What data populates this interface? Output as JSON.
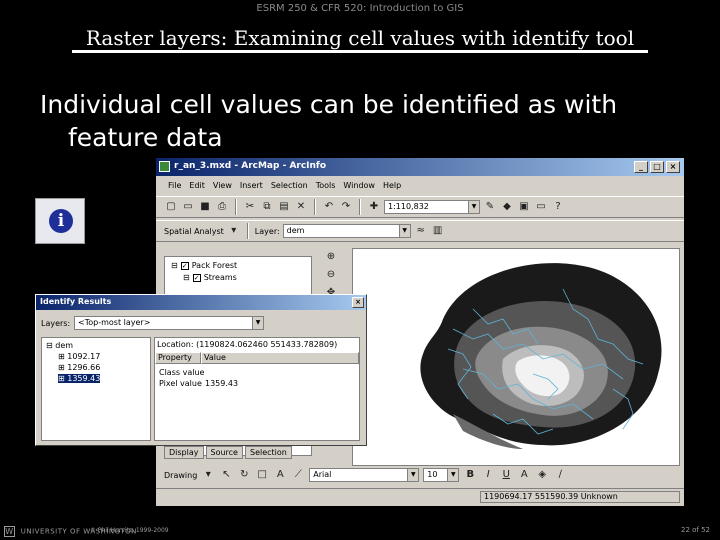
{
  "header": {
    "course": "ESRM 250 & CFR 520: Introduction to GIS"
  },
  "slide": {
    "title": "Raster layers: Examining cell values with identify tool",
    "bullet_line1": "Individual cell values can be identified as with",
    "bullet_line2": "feature data"
  },
  "arcmap": {
    "window_title": "r_an_3.mxd - ArcMap - ArcInfo",
    "menu": [
      "File",
      "Edit",
      "View",
      "Insert",
      "Selection",
      "Tools",
      "Window",
      "Help"
    ],
    "scale": "1:110,832",
    "spatial_analyst": "Spatial Analyst",
    "layer_label": "Layer:",
    "layer_value": "dem",
    "toc": {
      "root": "Pack Forest",
      "layer1": "Streams"
    },
    "tabs": [
      "Display",
      "Source",
      "Selection"
    ],
    "drawing": {
      "label": "Drawing",
      "font": "Arial",
      "size": "10",
      "b": "B",
      "i": "I",
      "u": "U"
    },
    "status_coords": "1190694.17 551590.39 Unknown"
  },
  "identify": {
    "title": "Identify Results",
    "layers_label": "Layers:",
    "layers_value": "<Top-most layer>",
    "tree": {
      "root": "dem",
      "items": [
        "1092.17",
        "1296.66",
        "1359.43"
      ]
    },
    "location": "Location: (1190824.062460 551433.782809)",
    "col_property": "Property",
    "col_value": "Value",
    "rows": [
      {
        "prop": "Class value",
        "val": ""
      },
      {
        "prop": "Pixel value",
        "val": "1359.43"
      }
    ]
  },
  "footer": {
    "logo": "UNIVERSITY OF WASHINGTON",
    "copyright": "© Phil Hurvitz, 1999-2009",
    "page": "22 of 52"
  }
}
